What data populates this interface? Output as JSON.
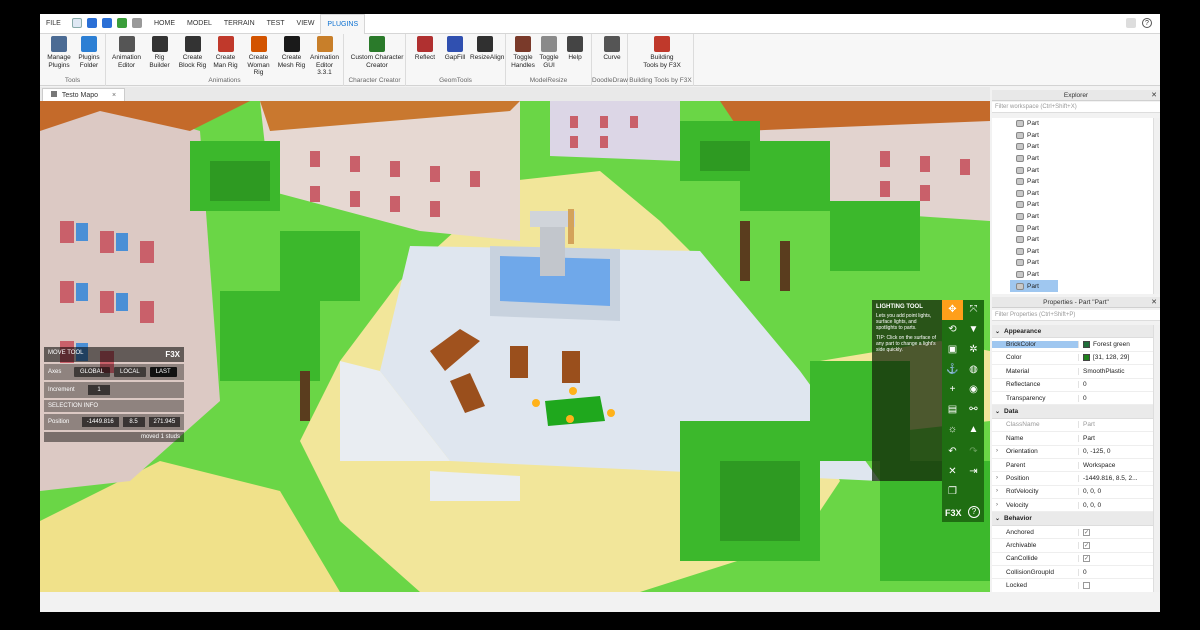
{
  "menubar": {
    "file_label": "FILE",
    "tabs": [
      "HOME",
      "MODEL",
      "TERRAIN",
      "TEST",
      "VIEW",
      "PLUGINS"
    ]
  },
  "ribbon": {
    "groups": [
      {
        "label": "Tools",
        "buttons": [
          "Manage\nPlugins",
          "Plugins\nFolder"
        ]
      },
      {
        "label": "Animations",
        "buttons": [
          "Animation\nEditor",
          "Rig\nBuilder",
          "Create\nBlock Rig",
          "Create\nMan Rig",
          "Create\nWoman Rig",
          "Create\nMesh Rig",
          "Animation\nEditor 3.3.1"
        ]
      },
      {
        "label": "Character Creator",
        "buttons": [
          "Custom Character\nCreator"
        ]
      },
      {
        "label": "GeomTools",
        "buttons": [
          "Reflect",
          "GapFill",
          "ResizeAlign"
        ]
      },
      {
        "label": "ModelResize",
        "buttons": [
          "Toggle\nHandles",
          "Toggle\nGUI",
          "Help"
        ]
      },
      {
        "label": "DoodleDraw",
        "buttons": [
          "Curve"
        ]
      },
      {
        "label": "Building Tools by F3X",
        "buttons": [
          "Building\nTools by F3X"
        ]
      }
    ]
  },
  "doc_tab": {
    "title": "Testo Mapo",
    "close": "×"
  },
  "move_tool": {
    "title": "MOVE TOOL",
    "brand": "F3X",
    "axes_label": "Axes",
    "axes_options": [
      "GLOBAL",
      "LOCAL",
      "LAST"
    ],
    "increment_label": "Increment",
    "increment_value": "1",
    "selection_label": "SELECTION INFO",
    "position_label": "Position",
    "position_values": [
      "-1449.816",
      "8.5",
      "271.945"
    ],
    "status": "moved 1 studs"
  },
  "lighting_tool": {
    "title": "LIGHTING TOOL",
    "desc": "Lets you add point lights, surface lights, and spotlights to parts.",
    "tip": "TIP: Click on the surface of any part to change a light's side quickly."
  },
  "f3x": {
    "label": "F3X",
    "help": "?"
  },
  "explorer": {
    "title": "Explorer",
    "filter_placeholder": "Filter workspace (Ctrl+Shift+X)",
    "items": [
      "Part",
      "Part",
      "Part",
      "Part",
      "Part",
      "Part",
      "Part",
      "Part",
      "Part",
      "Part",
      "Part",
      "Part",
      "Part",
      "Part",
      "Part"
    ]
  },
  "properties": {
    "title": "Properties - Part \"Part\"",
    "filter_placeholder": "Filter Properties (Ctrl+Shift+P)",
    "rows": [
      {
        "kind": "cat",
        "name": "Appearance"
      },
      {
        "kind": "prop",
        "name": "BrickColor",
        "value": "Forest green",
        "swatch": "#1f6e3a",
        "selected": true
      },
      {
        "kind": "prop",
        "name": "Color",
        "value": "[31, 128, 29]",
        "swatch": "#1f801d"
      },
      {
        "kind": "prop",
        "name": "Material",
        "value": "SmoothPlastic"
      },
      {
        "kind": "prop",
        "name": "Reflectance",
        "value": "0"
      },
      {
        "kind": "prop",
        "name": "Transparency",
        "value": "0"
      },
      {
        "kind": "cat",
        "name": "Data"
      },
      {
        "kind": "prop",
        "name": "ClassName",
        "value": "Part",
        "dim": true
      },
      {
        "kind": "prop",
        "name": "Name",
        "value": "Part"
      },
      {
        "kind": "prop",
        "name": "Orientation",
        "value": "0, -125, 0",
        "expand": true
      },
      {
        "kind": "prop",
        "name": "Parent",
        "value": "Workspace"
      },
      {
        "kind": "prop",
        "name": "Position",
        "value": "-1449.816, 8.5, 2...",
        "expand": true
      },
      {
        "kind": "prop",
        "name": "RotVelocity",
        "value": "0, 0, 0",
        "expand": true
      },
      {
        "kind": "prop",
        "name": "Velocity",
        "value": "0, 0, 0",
        "expand": true
      },
      {
        "kind": "cat",
        "name": "Behavior"
      },
      {
        "kind": "prop",
        "name": "Anchored",
        "check": true
      },
      {
        "kind": "prop",
        "name": "Archivable",
        "check": true
      },
      {
        "kind": "prop",
        "name": "CanCollide",
        "check": true
      },
      {
        "kind": "prop",
        "name": "CollisionGroupId",
        "value": "0"
      },
      {
        "kind": "prop",
        "name": "Locked",
        "check": false
      }
    ]
  },
  "colors": {
    "accent": "#0a70d1",
    "f3x_green": "#1f6e12",
    "tool_selected": "#ff9f1a",
    "selected_row": "#9fc7f0"
  }
}
